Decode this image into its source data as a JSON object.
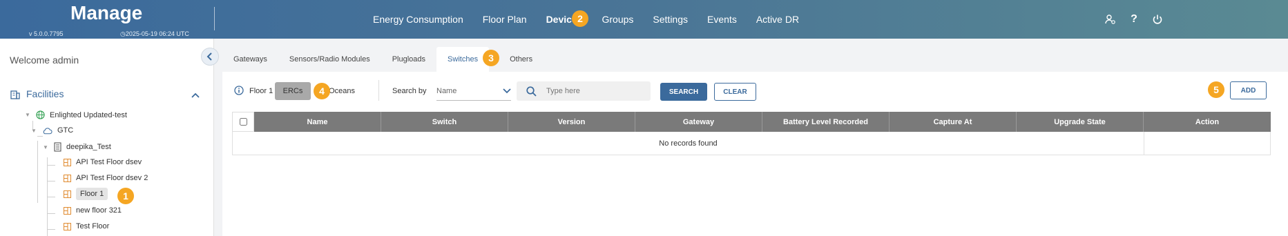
{
  "header": {
    "title": "Manage",
    "version": "v 5.0.0.7795",
    "date": "2025-05-19 06:24 UTC",
    "nav": [
      "Energy Consumption",
      "Floor Plan",
      "Devices",
      "Groups",
      "Settings",
      "Events",
      "Active DR"
    ],
    "active_nav": "Devices",
    "colors": {
      "header_start": "#3b6a9c",
      "header_end": "#5a8a93",
      "accent": "#3b6a9c",
      "badge": "#f5a623"
    }
  },
  "badges": [
    "1",
    "2",
    "3",
    "4",
    "5"
  ],
  "sidebar": {
    "welcome": "Welcome admin",
    "facilities_label": "Facilities",
    "tree": {
      "org": "Enlighted Updated-test",
      "campus": "GTC",
      "building": "deepika_Test",
      "floors": [
        "API Test Floor dsev",
        "API Test Floor dsev 2",
        "Floor 1",
        "new floor 321",
        "Test Floor"
      ]
    }
  },
  "tabs": [
    "Gateways",
    "Sensors/Radio Modules",
    "Plugloads",
    "Switches",
    "Others"
  ],
  "active_tab": "Switches",
  "toolbar": {
    "crumb": "Floor 1",
    "erc_label": "ERCs",
    "enocean_label": "nOceans",
    "search_by_label": "Search by",
    "search_by_value": "Name",
    "search_placeholder": "Type here",
    "search_label": "SEARCH",
    "clear_label": "CLEAR",
    "add_label": "ADD"
  },
  "table": {
    "columns": [
      "Name",
      "Switch",
      "Version",
      "Gateway",
      "Battery Level Recorded",
      "Capture At",
      "Upgrade State",
      "Action"
    ],
    "empty_message": "No records found"
  }
}
